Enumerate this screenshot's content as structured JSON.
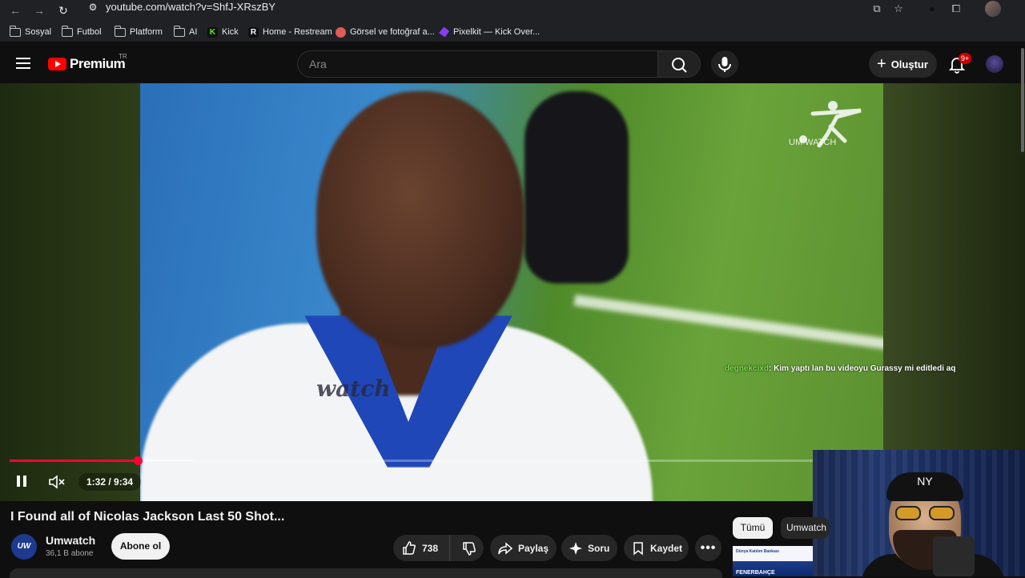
{
  "browser": {
    "url": "youtube.com/watch?v=ShfJ-XRszBY",
    "bookmarks": [
      {
        "label": "Sosyal",
        "icon": "folder-icon"
      },
      {
        "label": "Futbol",
        "icon": "folder-icon"
      },
      {
        "label": "Platform",
        "icon": "folder-icon"
      },
      {
        "label": "AI",
        "icon": "folder-icon"
      },
      {
        "label": "Kick",
        "icon": "kick-icon"
      },
      {
        "label": "Home - Restream",
        "icon": "restream-icon"
      },
      {
        "label": "Görsel ve fotoğraf a...",
        "icon": "image-site-icon"
      },
      {
        "label": "Pixelkit — Kick Over...",
        "icon": "pixelkit-icon"
      }
    ]
  },
  "header": {
    "brand": "Premium",
    "country": "TR",
    "search_placeholder": "Ara",
    "create_label": "Oluştur",
    "notification_badge": "9+"
  },
  "player": {
    "watermark_text": "watch",
    "channel_logo_text": "UM   WATCH",
    "chat_user": "degnekcixd",
    "chat_message": ": Kim yaptı lan bu videoyu Gurassy mi editledi aq",
    "time_display": "1:32 / 9:34",
    "progress_played": 0.16,
    "progress_buffered": 0.23,
    "colors": {
      "progress": "#ff0033"
    }
  },
  "webcam": {
    "cap_logo": "NY"
  },
  "video": {
    "title": "I Found all of Nicolas Jackson Last 50 Shot...",
    "channel_name": "Umwatch",
    "channel_avatar_text": "UW",
    "subscriber_count": "36,1 B abone",
    "subscribe_label": "Abone ol",
    "like_count": "738",
    "share_label": "Paylaş",
    "ask_label": "Soru",
    "save_label": "Kaydet"
  },
  "sidebar": {
    "chips": [
      "Tümü",
      "Umwatch"
    ],
    "thumb_bank": "Dünya Katılım Bankası",
    "thumb_text": "FENERBAHÇE"
  }
}
